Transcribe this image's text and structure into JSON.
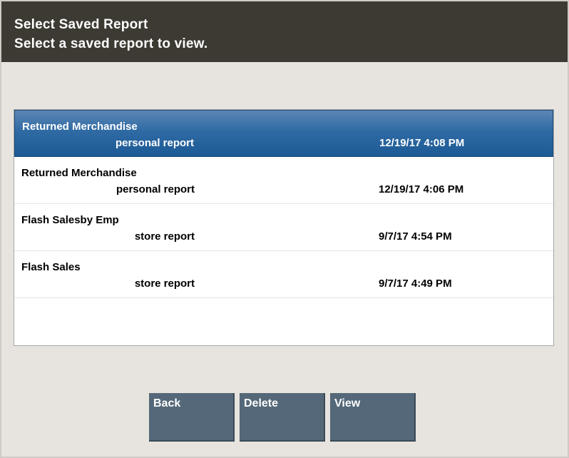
{
  "header": {
    "title": "Select Saved Report",
    "subtitle": "Select a saved report to view."
  },
  "reports": [
    {
      "name": "Returned Merchandise",
      "type": "personal report",
      "date": "12/19/17 4:08 PM",
      "selected": true
    },
    {
      "name": "Returned Merchandise",
      "type": "personal report",
      "date": "12/19/17 4:06 PM",
      "selected": false
    },
    {
      "name": "Flash Salesby Emp",
      "type": "store report",
      "date": "9/7/17 4:54 PM",
      "selected": false
    },
    {
      "name": "Flash Sales",
      "type": "store report",
      "date": "9/7/17 4:49 PM",
      "selected": false
    }
  ],
  "buttons": {
    "back": "Back",
    "delete": "Delete",
    "view": "View"
  },
  "colors": {
    "header_bg": "#3d3a33",
    "selected_row": "#2f6aa3",
    "button_bg": "#546879",
    "page_bg": "#e7e3de"
  }
}
